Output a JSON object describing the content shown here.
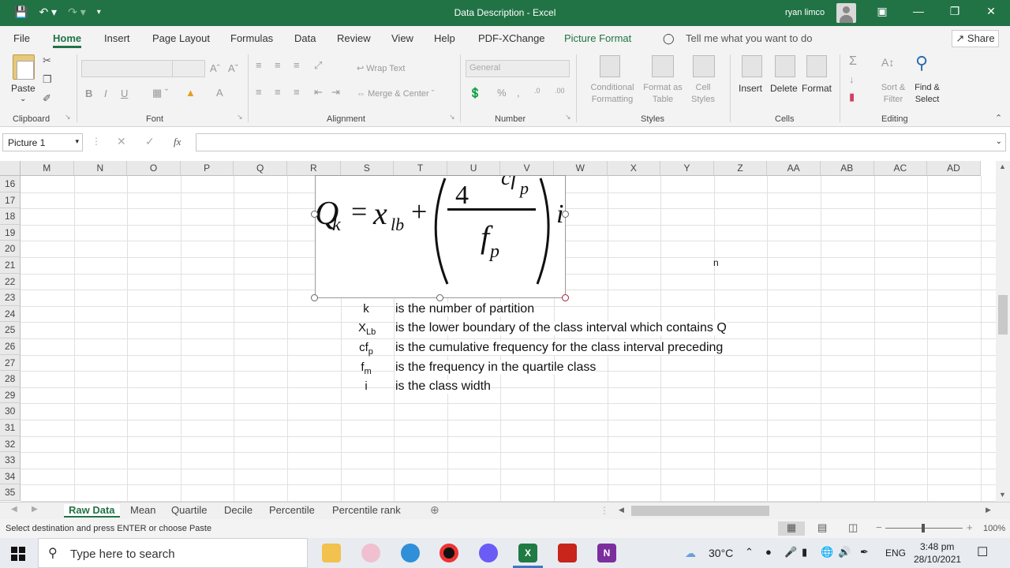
{
  "window": {
    "title": "Data Description - Excel",
    "user_name": "ryan limco"
  },
  "tabs": {
    "file": "File",
    "home": "Home",
    "insert": "Insert",
    "page_layout": "Page Layout",
    "formulas": "Formulas",
    "data": "Data",
    "review": "Review",
    "view": "View",
    "help": "Help",
    "pdf_xchange": "PDF-XChange",
    "picture_format": "Picture Format",
    "tell_me": "Tell me what you want to do",
    "share": "Share"
  },
  "ribbon": {
    "clipboard": {
      "label": "Clipboard",
      "paste": "Paste"
    },
    "font": {
      "label": "Font",
      "bold": "B",
      "italic": "I",
      "underline": "U"
    },
    "alignment": {
      "label": "Alignment",
      "wrap_text": "Wrap Text",
      "merge_center": "Merge & Center"
    },
    "number": {
      "label": "Number",
      "format": "General"
    },
    "styles": {
      "label": "Styles",
      "conditional_formatting": "Conditional Formatting",
      "format_as_table": "Format as Table",
      "cell_styles": "Cell Styles"
    },
    "cells": {
      "label": "Cells",
      "insert": "Insert",
      "delete": "Delete",
      "format": "Format"
    },
    "editing": {
      "label": "Editing",
      "sort_filter": "Sort & Filter",
      "find_select": "Find & Select"
    }
  },
  "formula_bar": {
    "name_box": "Picture 1",
    "fx": "fx",
    "content": ""
  },
  "grid": {
    "columns": [
      "M",
      "N",
      "O",
      "P",
      "Q",
      "R",
      "S",
      "T",
      "U",
      "V",
      "W",
      "X",
      "Y",
      "Z",
      "AA",
      "AB",
      "AC",
      "AD"
    ],
    "rows": [
      "16",
      "17",
      "18",
      "19",
      "20",
      "21",
      "22",
      "23",
      "24",
      "25",
      "26",
      "27",
      "28",
      "29",
      "30",
      "31",
      "32",
      "33",
      "34",
      "35"
    ],
    "cell_n": "n",
    "definitions": [
      {
        "symbol": "k",
        "sub": "",
        "text": "is the number of partition"
      },
      {
        "symbol": "X",
        "sub": "Lb",
        "text": "is the lower boundary of the class interval which contains Q"
      },
      {
        "symbol": "cf",
        "sub": "p",
        "text": "is the cumulative frequency for the class interval preceding"
      },
      {
        "symbol": "f",
        "sub": "m",
        "text": "is the frequency in the quartile class"
      },
      {
        "symbol": "i",
        "sub": "",
        "text": "is the class width"
      }
    ]
  },
  "formula_image": {
    "lhs": "Q",
    "lhs_sub": "k",
    "equals": "=",
    "x": "x",
    "x_sub": "lb",
    "plus": "+",
    "numerator_top": "4",
    "numerator_right": "cf",
    "numerator_right_sub": "p",
    "denominator": "f",
    "denominator_sub": "p",
    "tail": "i"
  },
  "sheets": {
    "tabs": [
      "Raw Data",
      "Mean",
      "Quartile",
      "Decile",
      "Percentile",
      "Percentile rank"
    ],
    "active": "Raw Data"
  },
  "status": {
    "message": "Select destination and press ENTER or choose Paste",
    "zoom": "100%"
  },
  "taskbar": {
    "search_placeholder": "Type here to search",
    "weather": "30°C",
    "language": "ENG",
    "time": "3:48 pm",
    "date": "28/10/2021"
  }
}
